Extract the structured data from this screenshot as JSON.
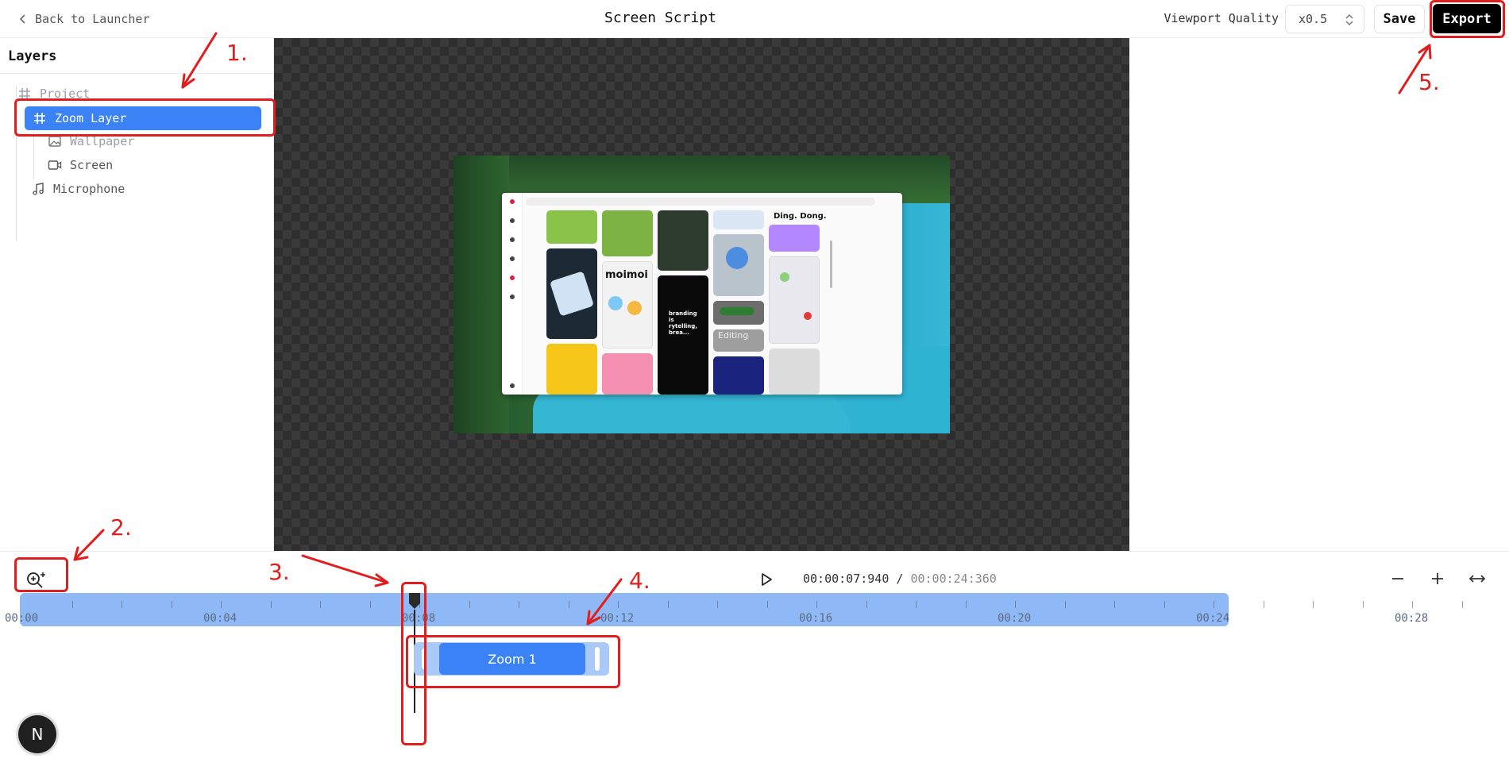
{
  "topbar": {
    "back_label": "Back to Launcher",
    "title": "Screen Script",
    "viewport_quality_label": "Viewport Quality",
    "viewport_quality_value": "x0.5",
    "save_label": "Save",
    "export_label": "Export"
  },
  "layers": {
    "title": "Layers",
    "items": [
      {
        "label": "Project",
        "icon": "hash-icon"
      },
      {
        "label": "Zoom Layer",
        "icon": "hash-icon",
        "selected": true
      },
      {
        "label": "Wallpaper",
        "icon": "image-icon"
      },
      {
        "label": "Screen",
        "icon": "video-icon"
      },
      {
        "label": "Microphone",
        "icon": "music-note-icon"
      }
    ]
  },
  "preview": {
    "tile_texts": [
      "Ding. Dong.",
      "moimoi",
      "branding is rytelling, brea...",
      "Editing"
    ]
  },
  "timeline": {
    "current_time": "00:00:07:940",
    "separator": "/",
    "total_time": "00:00:24:360",
    "tick_labels": [
      "00:00",
      "00:04",
      "00:08",
      "00:12",
      "00:16",
      "00:20",
      "00:24",
      "00:28"
    ],
    "zoom_segment_label": "Zoom 1",
    "badge_letter": "N"
  },
  "annotations": {
    "labels": [
      "1.",
      "2.",
      "3.",
      "4.",
      "5."
    ],
    "color": "#e11d1d"
  },
  "colors": {
    "accent": "#3b82f6",
    "ruler": "#8fb8f6",
    "export_bg": "#000000"
  }
}
